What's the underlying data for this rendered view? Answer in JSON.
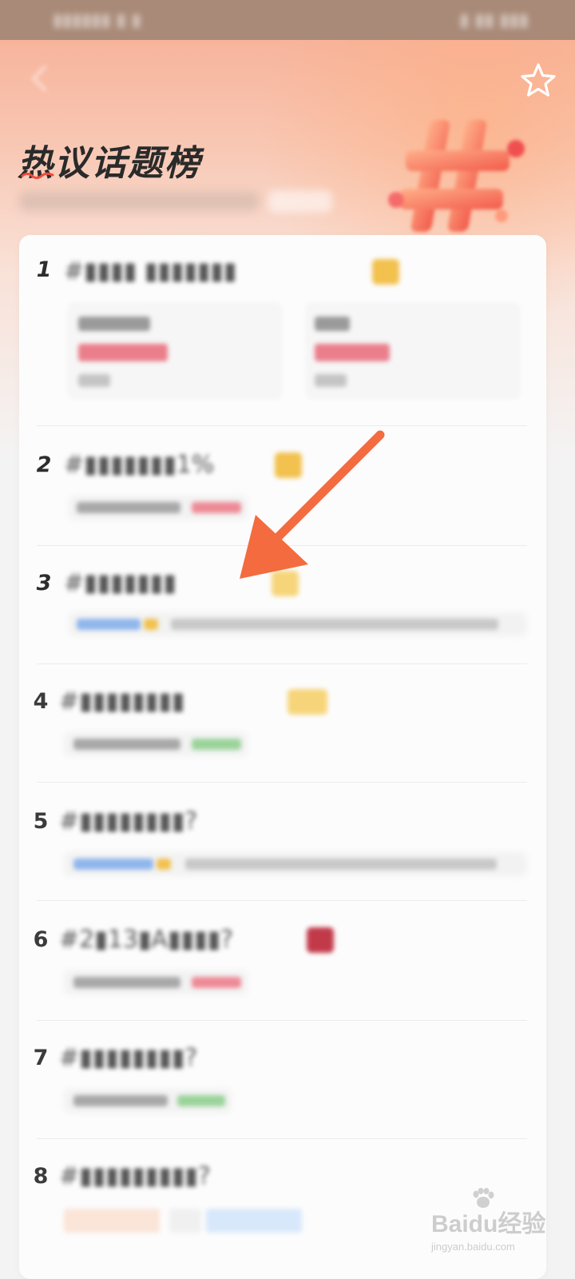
{
  "page": {
    "title": "热议话题榜"
  },
  "icons": {
    "favorite": "star-icon",
    "back": "back-arrow-icon"
  },
  "topics": [
    {
      "rank": "1"
    },
    {
      "rank": "2"
    },
    {
      "rank": "3"
    },
    {
      "rank": "4"
    },
    {
      "rank": "5"
    },
    {
      "rank": "6"
    },
    {
      "rank": "7"
    },
    {
      "rank": "8"
    }
  ],
  "colors": {
    "accent": "#f36b3f",
    "status_bar": "#a98a78",
    "up": "#e25566",
    "down": "#6cc36c",
    "tag_yellow": "#f2c14e",
    "tag_red": "#c23a4a"
  },
  "watermark": {
    "brand": "Baidu经验",
    "domain": "jingyan.baidu.com"
  }
}
